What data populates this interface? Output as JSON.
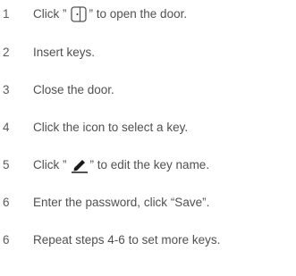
{
  "steps": [
    {
      "num": "1",
      "pre": "Click ”",
      "icon": "door-icon",
      "post": "” to open the door."
    },
    {
      "num": "2",
      "text": "Insert keys."
    },
    {
      "num": "3",
      "text": "Close the door."
    },
    {
      "num": "4",
      "text": "Click the icon to select a key."
    },
    {
      "num": "5",
      "pre": "Click ”",
      "icon": "pen-icon",
      "post": "” to edit the key name."
    },
    {
      "num": "6",
      "text": "Enter the password, click “Save”."
    },
    {
      "num": "6",
      "text": "Repeat steps 4-6 to set more keys."
    }
  ]
}
